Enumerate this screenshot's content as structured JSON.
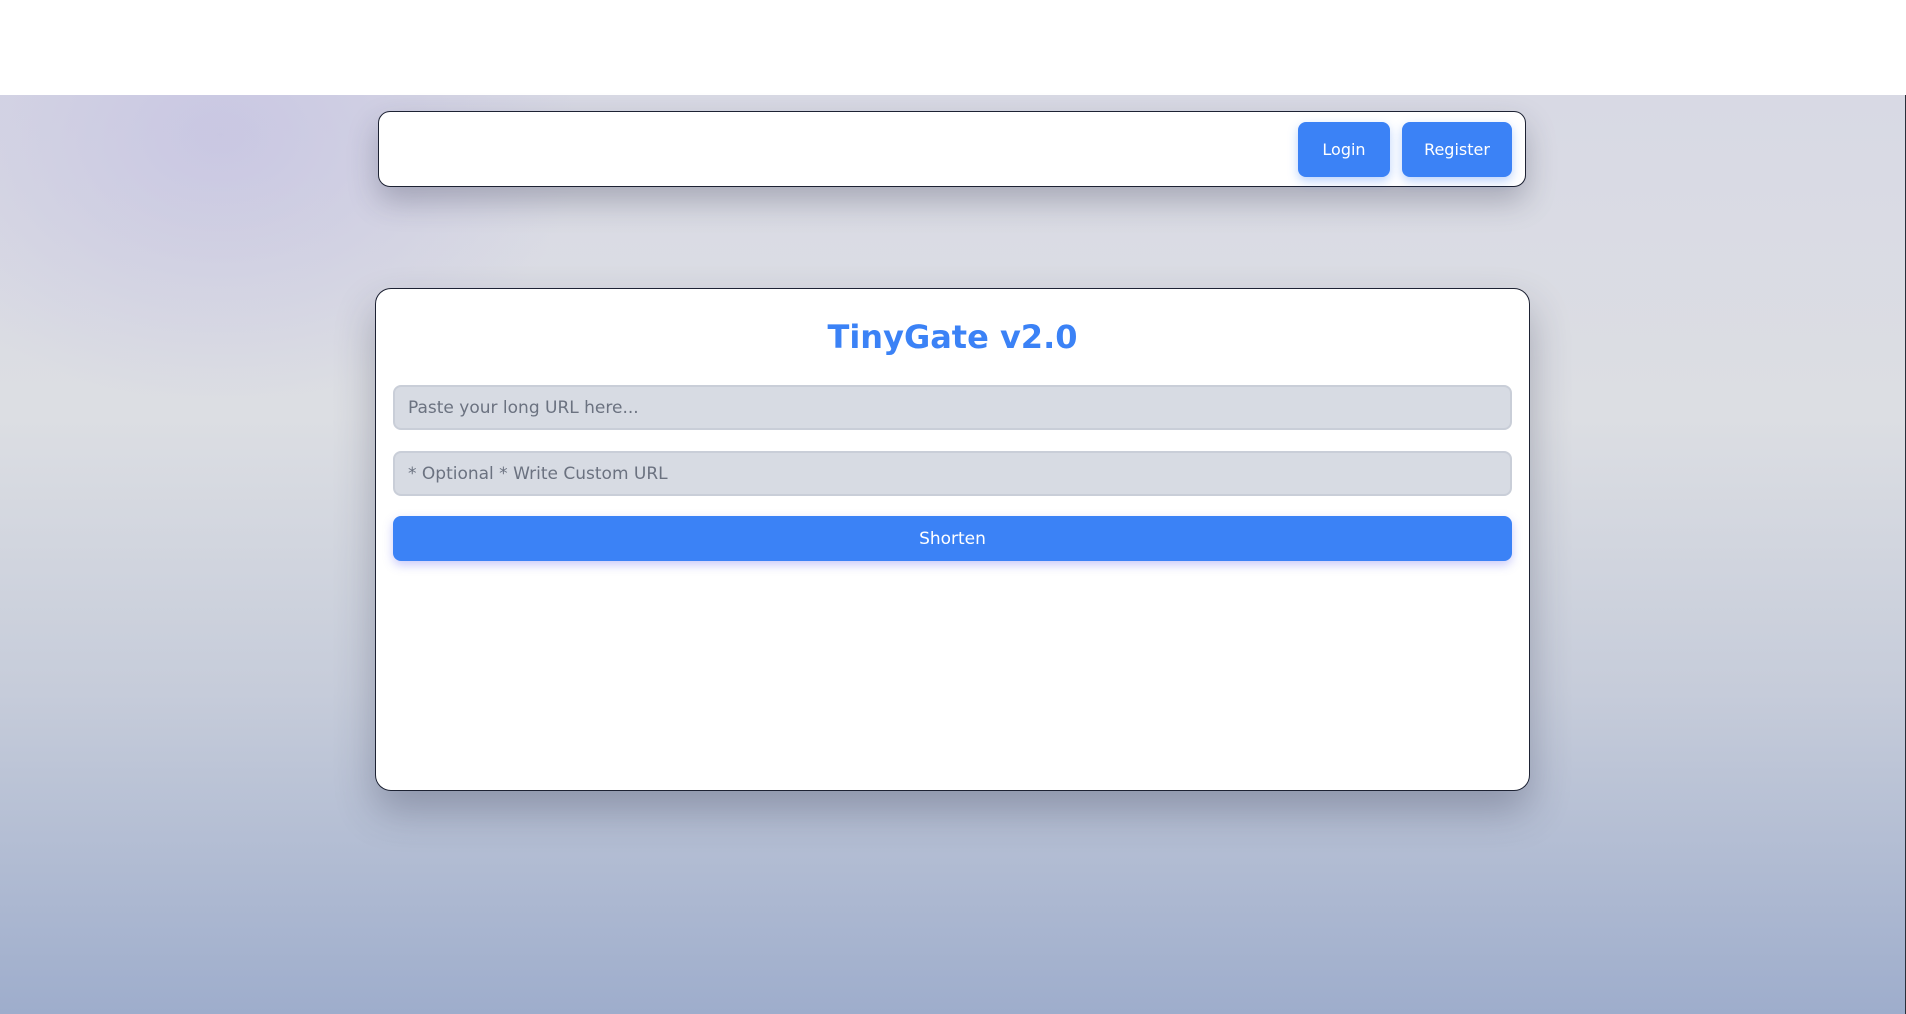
{
  "navbar": {
    "login_label": "Login",
    "register_label": "Register"
  },
  "shortener": {
    "title": "TinyGate v2.0",
    "url_input": {
      "placeholder": "Paste your long URL here...",
      "value": ""
    },
    "custom_input": {
      "placeholder": "* Optional * Write Custom URL",
      "value": ""
    },
    "shorten_label": "Shorten"
  },
  "colors": {
    "accent": "#3b82f6",
    "input_bg": "#d7dbe3",
    "border": "#1d2233"
  }
}
